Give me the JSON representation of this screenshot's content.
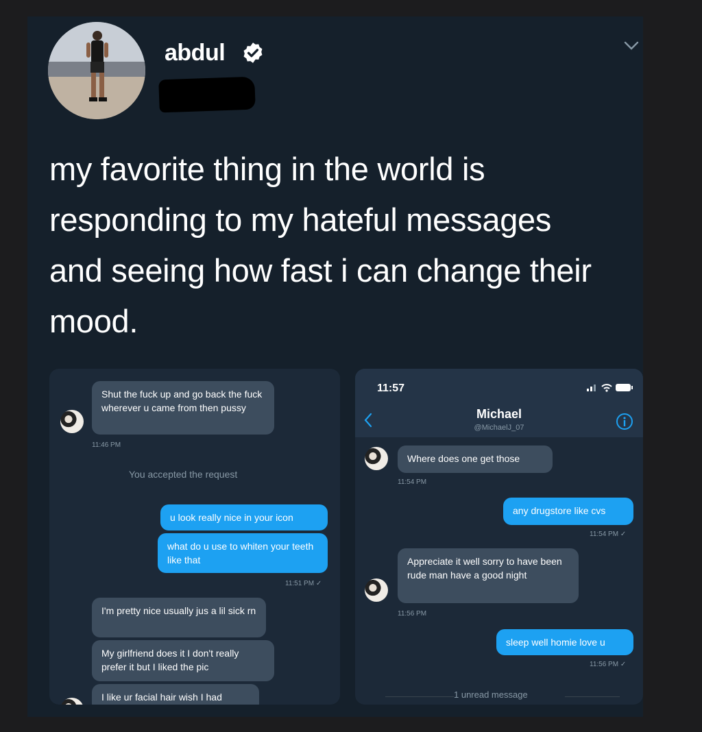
{
  "tweet": {
    "display_name": "abdul",
    "text": "my favorite thing in the world is responding to my hateful messages and seeing how fast i can change their mood."
  },
  "left_chat": {
    "msg1": "Shut the fuck up and go back the fuck wherever u came from then pussy",
    "time1": "11:46 PM",
    "system": "You accepted the request",
    "out1": "u look really nice in your icon",
    "out2": "what do u use to whiten your teeth like that",
    "time2": "11:51 PM ✓",
    "in2": "I'm pretty nice usually jus a lil sick rn",
    "in3": "My girlfriend does it I don't really prefer it but I liked the pic",
    "in4": "I like ur facial hair wish I had"
  },
  "right_chat": {
    "status_time": "11:57",
    "name": "Michael",
    "handle": "@MichaelJ_07",
    "in1": "Where does one get those",
    "time1": "11:54 PM",
    "out1": "any drugstore like cvs",
    "time2": "11:54 PM ✓",
    "in2": "Appreciate it well sorry to have been rude man have a good night",
    "time3": "11:56 PM",
    "out2": "sleep well homie love u",
    "time4": "11:56 PM ✓",
    "unread": "1 unread message"
  },
  "colors": {
    "background": "#15202b",
    "outgoing_bubble": "#1da1f2",
    "incoming_bubble": "#3d4d5e",
    "verified": "#ffffff"
  }
}
